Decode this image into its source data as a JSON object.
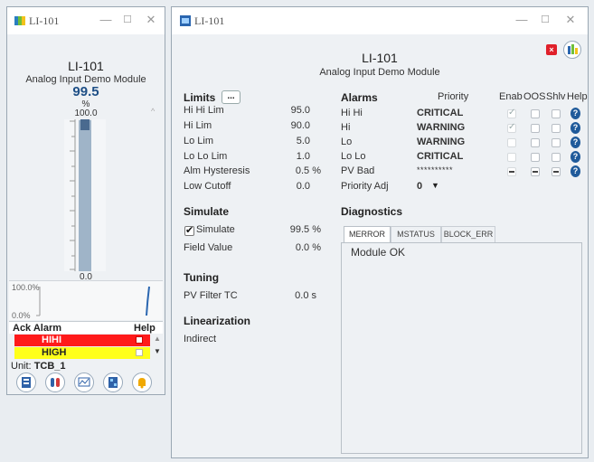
{
  "small": {
    "title": "LI-101",
    "tag": "LI-101",
    "desc": "Analog Input Demo Module",
    "pv": "99.5",
    "units": "%",
    "scale_high": "100.0",
    "scale_low": "0.0",
    "trend_high": "100.0%",
    "trend_low": "0.0%",
    "ack_alarm": "Ack Alarm",
    "help": "Help",
    "alarm_rows": [
      {
        "label": "HIHI",
        "color": "#ff1a1a"
      },
      {
        "label": "HIGH",
        "color": "#ffff1a"
      }
    ],
    "unit_label": "Unit:",
    "unit_value": "TCB_1",
    "bar_fraction": 0.995,
    "icons": [
      "faceplate-icon",
      "detail-icon",
      "trend-icon",
      "module-icon",
      "alarm-bell-icon"
    ]
  },
  "large": {
    "title": "LI-101",
    "tag": "LI-101",
    "desc": "Analog Input Demo Module",
    "limits": {
      "header": "Limits",
      "more": "...",
      "rows": [
        {
          "label": "Hi Hi Lim",
          "value": "95.0"
        },
        {
          "label": "Hi Lim",
          "value": "90.0"
        },
        {
          "label": "Lo Lim",
          "value": "5.0"
        },
        {
          "label": "Lo Lo Lim",
          "value": "1.0"
        },
        {
          "label": "Alm Hysteresis",
          "value": "0.5 %"
        },
        {
          "label": "Low Cutoff",
          "value": "0.0"
        }
      ]
    },
    "simulate": {
      "header": "Simulate",
      "check_label": "Simulate",
      "check_value": "99.5 %",
      "field_label": "Field Value",
      "field_value": "0.0 %"
    },
    "tuning": {
      "header": "Tuning",
      "label": "PV Filter TC",
      "value": "0.0 s"
    },
    "linearization": {
      "header": "Linearization",
      "value": "Indirect"
    },
    "alarms": {
      "header": "Alarms",
      "col_priority": "Priority",
      "col_enab": "Enab",
      "col_oos": "OOS",
      "col_shlv": "Shlv",
      "col_help": "Help",
      "rows": [
        {
          "name": "Hi Hi",
          "priority": "CRITICAL",
          "bold": true
        },
        {
          "name": "Hi",
          "priority": "WARNING",
          "bold": true
        },
        {
          "name": "Lo",
          "priority": "WARNING",
          "bold": true
        },
        {
          "name": "Lo Lo",
          "priority": "CRITICAL",
          "bold": true
        },
        {
          "name": "PV Bad",
          "priority": "**********",
          "bold": false
        }
      ],
      "priority_adj_label": "Priority Adj",
      "priority_adj_value": "0"
    },
    "diagnostics": {
      "header": "Diagnostics",
      "tabs": [
        "MERROR",
        "MSTATUS",
        "BLOCK_ERR"
      ],
      "content": "Module OK"
    }
  }
}
